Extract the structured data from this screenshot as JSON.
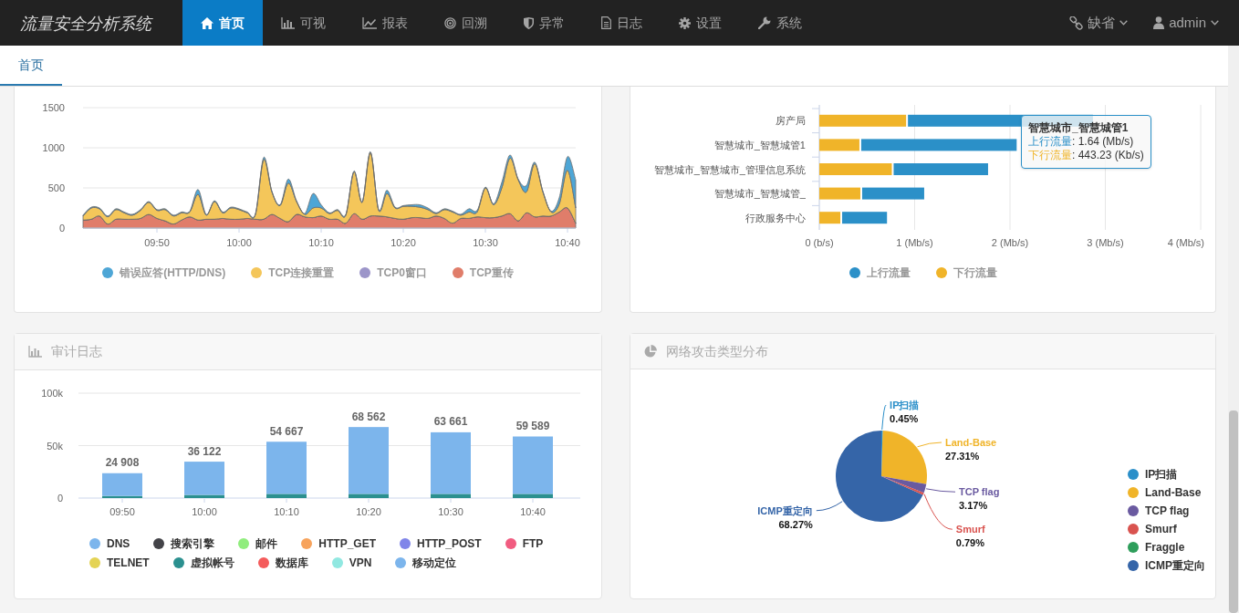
{
  "navbar": {
    "brand": "流量安全分析系统",
    "items": [
      {
        "label": "首页",
        "selected": true
      },
      {
        "label": "可视",
        "selected": false
      },
      {
        "label": "报表",
        "selected": false
      },
      {
        "label": "回溯",
        "selected": false
      },
      {
        "label": "异常",
        "selected": false
      },
      {
        "label": "日志",
        "selected": false
      },
      {
        "label": "设置",
        "selected": false
      },
      {
        "label": "系统",
        "selected": false
      }
    ],
    "right_menus": [
      {
        "label": "缺省"
      },
      {
        "label": "admin"
      }
    ]
  },
  "tabs": [
    {
      "label": "首页",
      "selected": true
    }
  ],
  "panels": [
    {
      "chart_data": {
        "type": "area",
        "stacked": true,
        "grid": true,
        "x": [
          581,
          582,
          583,
          584,
          585,
          586,
          587,
          588,
          589,
          590,
          591,
          592,
          593,
          594,
          595,
          596,
          597,
          598,
          599,
          600,
          601,
          602,
          603,
          604,
          605,
          606,
          607,
          608,
          609,
          610,
          611,
          612,
          613,
          614,
          615,
          616,
          617,
          618,
          619,
          620,
          621,
          622,
          623,
          624,
          625,
          626,
          627,
          628,
          629,
          630,
          631,
          632,
          633,
          634,
          635,
          636,
          637,
          638,
          639,
          640,
          641
        ],
        "series": [
          {
            "name": "TCP重传",
            "color": "#e07d6a",
            "values": [
              100,
              110,
              150,
              50,
              110,
              110,
              110,
              120,
              170,
              120,
              90,
              50,
              100,
              140,
              100,
              110,
              110,
              120,
              110,
              110,
              120,
              110,
              110,
              170,
              120,
              80,
              170,
              140,
              130,
              150,
              110,
              110,
              60,
              180,
              110,
              150,
              150,
              140,
              120,
              110,
              130,
              130,
              120,
              150,
              120,
              60,
              120,
              120,
              140,
              130,
              130,
              150,
              180,
              90,
              190,
              140,
              150,
              150,
              200,
              250,
              60
            ]
          },
          {
            "name": "TCP0窗口",
            "color": "#9c95c9",
            "values": [
              0,
              0,
              0,
              0,
              0,
              0,
              0,
              0,
              0,
              0,
              0,
              0,
              0,
              0,
              0,
              0,
              0,
              0,
              0,
              0,
              0,
              0,
              0,
              0,
              0,
              0,
              0,
              0,
              0,
              0,
              0,
              0,
              0,
              0,
              0,
              0,
              0,
              0,
              0,
              0,
              0,
              0,
              0,
              0,
              0,
              0,
              0,
              0,
              0,
              0,
              0,
              0,
              0,
              0,
              0,
              0,
              0,
              0,
              0,
              0,
              0
            ]
          },
          {
            "name": "TCP连接重置",
            "color": "#f4c65a",
            "values": [
              50,
              140,
              90,
              90,
              120,
              80,
              50,
              100,
              150,
              100,
              140,
              100,
              90,
              60,
              320,
              50,
              220,
              70,
              140,
              120,
              70,
              60,
              740,
              280,
              160,
              480,
              160,
              30,
              120,
              100,
              70,
              110,
              100,
              520,
              210,
              790,
              70,
              290,
              130,
              160,
              140,
              130,
              110,
              30,
              110,
              140,
              40,
              80,
              60,
              370,
              160,
              350,
              690,
              510,
              260,
              660,
              300,
              50,
              100,
              470,
              190
            ]
          },
          {
            "name": "错误应答(HTTP/DNS)",
            "color": "#4ea6d6",
            "values": [
              10,
              10,
              10,
              10,
              10,
              10,
              10,
              10,
              10,
              10,
              10,
              10,
              10,
              10,
              60,
              10,
              10,
              10,
              10,
              10,
              10,
              10,
              30,
              10,
              10,
              50,
              10,
              10,
              180,
              40,
              10,
              10,
              10,
              10,
              10,
              10,
              10,
              40,
              10,
              10,
              20,
              30,
              20,
              10,
              10,
              10,
              10,
              40,
              20,
              10,
              10,
              70,
              40,
              10,
              80,
              20,
              10,
              10,
              80,
              170,
              350
            ]
          }
        ],
        "xlim": [
          581,
          641
        ],
        "ylim": [
          0,
          1500
        ],
        "yticks": [
          0,
          500,
          1000,
          1500
        ],
        "xticks": [
          {
            "value": 590,
            "label": "09:50"
          },
          {
            "value": 600,
            "label": "10:00"
          },
          {
            "value": 610,
            "label": "10:10"
          },
          {
            "value": 620,
            "label": "10:20"
          },
          {
            "value": 630,
            "label": "10:30"
          },
          {
            "value": 640,
            "label": "10:40"
          }
        ]
      }
    },
    {
      "chart_data": {
        "type": "bar",
        "orientation": "horizontal",
        "stacked": true,
        "grid": true,
        "categories": [
          "房产局",
          "智慧城市_智慧城管1",
          "智慧城市_智慧城市_管理信息系统",
          "智慧城市_智慧城管_",
          "行政服务中心"
        ],
        "series": [
          {
            "name": "下行流量",
            "color": "#f0b429",
            "values": [
              0.92,
              0.43,
              0.77,
              0.44,
              0.23
            ]
          },
          {
            "name": "上行流量",
            "color": "#2b90c8",
            "values": [
              1.95,
              1.64,
              1.0,
              0.66,
              0.48
            ]
          }
        ],
        "xlim": [
          0,
          4
        ],
        "xticks": [
          {
            "value": 0,
            "label": "0 (b/s)"
          },
          {
            "value": 1,
            "label": "1 (Mb/s)"
          },
          {
            "value": 2,
            "label": "2 (Mb/s)"
          },
          {
            "value": 3,
            "label": "3 (Mb/s)"
          },
          {
            "value": 4,
            "label": "4 (Mb/s)"
          }
        ]
      },
      "tooltip": {
        "title": "智慧城市_智慧城管1",
        "rows": [
          {
            "label": "上行流量",
            "value": ": 1.64 (Mb/s)"
          },
          {
            "label": "下行流量",
            "value": ": 443.23 (Kb/s)"
          }
        ]
      }
    },
    {
      "title": "审计日志",
      "chart_data": {
        "type": "bar",
        "orientation": "vertical",
        "stacked": true,
        "grid": true,
        "categories": [
          "09:50",
          "10:00",
          "10:10",
          "10:20",
          "10:30",
          "10:40"
        ],
        "series": [
          {
            "name": "移动定位",
            "color": "#7cb5ec",
            "values": [
              0,
              0,
              0,
              0,
              0,
              0
            ]
          },
          {
            "name": "VPN",
            "color": "#91e8e1",
            "values": [
              0,
              0,
              0,
              0,
              0,
              0
            ]
          },
          {
            "name": "数据库",
            "color": "#f45b5b",
            "values": [
              0,
              0,
              0,
              0,
              0,
              0
            ]
          },
          {
            "name": "虚拟帐号",
            "color": "#2b908f",
            "values": [
              2000,
              3000,
              4000,
              4000,
              4000,
              4000
            ]
          },
          {
            "name": "TELNET",
            "color": "#e4d354",
            "values": [
              0,
              0,
              0,
              0,
              0,
              0
            ]
          },
          {
            "name": "FTP",
            "color": "#f15c80",
            "values": [
              0,
              0,
              0,
              0,
              0,
              0
            ]
          },
          {
            "name": "HTTP_POST",
            "color": "#8085e9",
            "values": [
              0,
              0,
              0,
              0,
              0,
              0
            ]
          },
          {
            "name": "HTTP_GET",
            "color": "#f7a35c",
            "values": [
              0,
              0,
              0,
              0,
              0,
              0
            ]
          },
          {
            "name": "邮件",
            "color": "#90ed7d",
            "values": [
              0,
              0,
              0,
              0,
              0,
              0
            ]
          },
          {
            "name": "搜索引擎",
            "color": "#434348",
            "values": [
              0,
              0,
              0,
              0,
              0,
              0
            ]
          },
          {
            "name": "DNS",
            "color": "#7cb5ec",
            "values": [
              23000,
              33000,
              51000,
              65000,
              60000,
              56000
            ]
          }
        ],
        "ylim": [
          0,
          100000
        ],
        "yticks": [
          0,
          {
            "value": 50000,
            "label": "50k"
          },
          {
            "value": 100000,
            "label": "100k"
          }
        ],
        "value_labels": [
          "24 908",
          "36 122",
          "54 667",
          "68 562",
          "63 661",
          "59 589"
        ]
      }
    },
    {
      "title": "网络攻击类型分布",
      "chart_data": {
        "type": "pie",
        "categories": [
          "IP扫描",
          "Land-Base",
          "TCP flag",
          "Smurf",
          "Fraggle",
          "ICMP重定向"
        ],
        "series": [
          {
            "colors": [
              "#2b8fc9",
              "#f0b429",
              "#6a5aa0",
              "#d9534f",
              "#2e9e5b",
              "#3565a8"
            ],
            "values": [
              0.45,
              27.31,
              3.17,
              0.79,
              0,
              68.27
            ]
          }
        ],
        "value_labels": [
          "0.45%",
          "27.31%",
          "3.17%",
          "0.79%",
          null,
          "68.27%"
        ]
      }
    }
  ]
}
